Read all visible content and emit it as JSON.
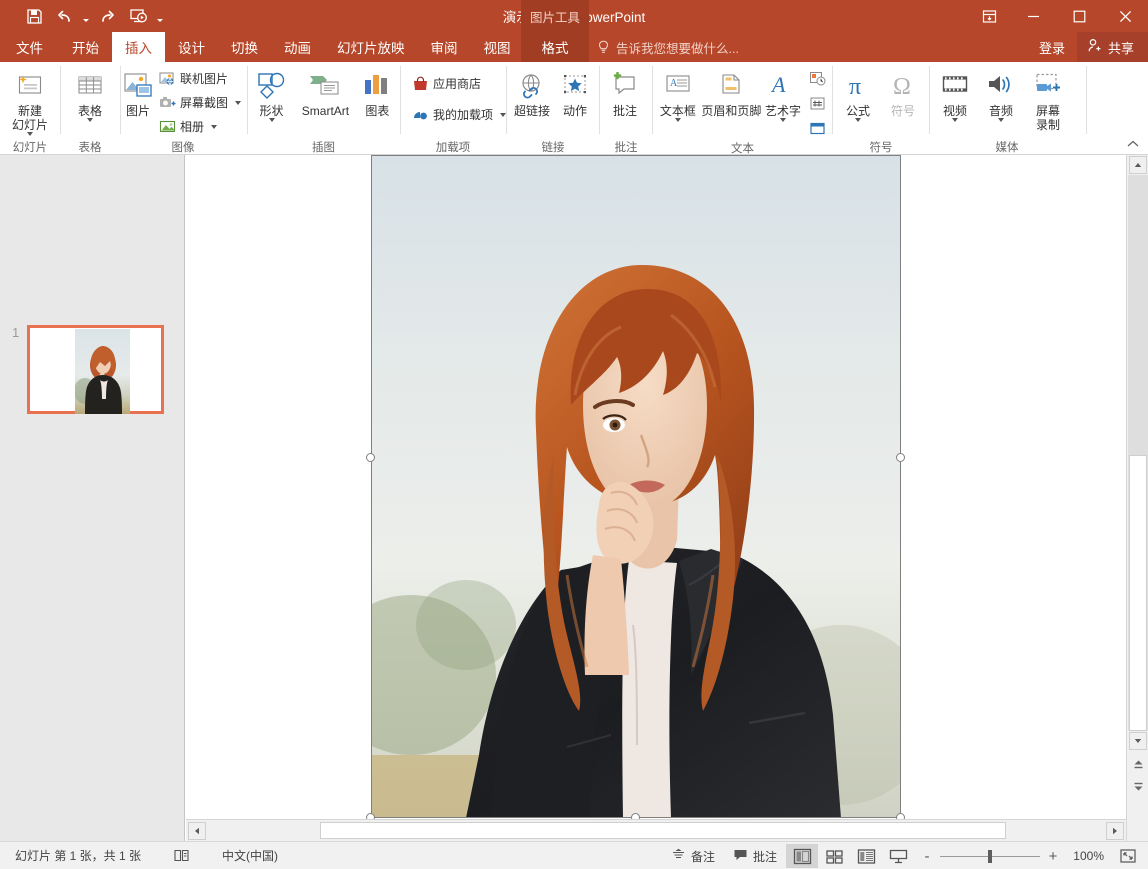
{
  "titlebar": {
    "document_title": "演示文稿1 - PowerPoint",
    "qat": [
      {
        "name": "save-icon",
        "label": "保存"
      },
      {
        "name": "undo-icon",
        "label": "撤消"
      },
      {
        "name": "redo-icon",
        "label": "恢复"
      },
      {
        "name": "start-slideshow-icon",
        "label": "从头开始"
      },
      {
        "name": "customize-qat-icon",
        "label": "自定义快速访问工具栏"
      }
    ],
    "window_controls": [
      {
        "name": "ribbon-display-options",
        "label": "功能区显示选项"
      },
      {
        "name": "minimize",
        "label": "最小化"
      },
      {
        "name": "maximize",
        "label": "最大化"
      },
      {
        "name": "close",
        "label": "关闭"
      }
    ]
  },
  "tabs": [
    {
      "label": "文件",
      "active": false
    },
    {
      "label": "开始",
      "active": false
    },
    {
      "label": "插入",
      "active": true
    },
    {
      "label": "设计",
      "active": false
    },
    {
      "label": "切换",
      "active": false
    },
    {
      "label": "动画",
      "active": false
    },
    {
      "label": "幻灯片放映",
      "active": false
    },
    {
      "label": "审阅",
      "active": false
    },
    {
      "label": "视图",
      "active": false
    }
  ],
  "contextual_tab": {
    "title": "图片工具",
    "label": "格式"
  },
  "tellme": {
    "placeholder": "告诉我您想要做什么...",
    "icon": "lightbulb-icon"
  },
  "account": {
    "signin_label": "登录",
    "share_label": "共享",
    "share_icon": "person-add-icon"
  },
  "ribbon": {
    "collapse_label": "折叠功能区",
    "groups": [
      {
        "name": "slides",
        "label": "幻灯片",
        "items": [
          {
            "type": "big",
            "name": "new-slide",
            "label": "新建\n幻灯片",
            "icon": "new-slide-icon",
            "has_caret": true
          }
        ]
      },
      {
        "name": "tables",
        "label": "表格",
        "items": [
          {
            "type": "big",
            "name": "table",
            "label": "表格",
            "icon": "table-icon",
            "has_caret": true
          }
        ]
      },
      {
        "name": "images",
        "label": "图像",
        "items": [
          {
            "type": "big",
            "name": "picture",
            "label": "图片",
            "icon": "picture-icon",
            "has_caret": false
          },
          {
            "type": "small",
            "name": "online-pictures",
            "label": "联机图片",
            "icon": "online-pictures-icon",
            "has_caret": false
          },
          {
            "type": "small",
            "name": "screenshot",
            "label": "屏幕截图",
            "icon": "screenshot-icon",
            "has_caret": true
          },
          {
            "type": "small",
            "name": "photo-album",
            "label": "相册",
            "icon": "photo-album-icon",
            "has_caret": true
          }
        ]
      },
      {
        "name": "illustrations",
        "label": "插图",
        "items": [
          {
            "type": "big",
            "name": "shapes",
            "label": "形状",
            "icon": "shapes-icon",
            "has_caret": true
          },
          {
            "type": "big",
            "name": "smartart",
            "label": "SmartArt",
            "icon": "smartart-icon",
            "has_caret": false
          },
          {
            "type": "big",
            "name": "chart",
            "label": "图表",
            "icon": "chart-icon",
            "has_caret": false
          }
        ]
      },
      {
        "name": "addins",
        "label": "加载项",
        "items": [
          {
            "type": "small",
            "name": "store",
            "label": "应用商店",
            "icon": "store-icon",
            "has_caret": false
          },
          {
            "type": "small",
            "name": "my-addins",
            "label": "我的加载项",
            "icon": "my-addins-icon",
            "has_caret": true
          }
        ]
      },
      {
        "name": "links",
        "label": "链接",
        "items": [
          {
            "type": "big",
            "name": "hyperlink",
            "label": "超链接",
            "icon": "hyperlink-icon",
            "has_caret": false
          },
          {
            "type": "big",
            "name": "action",
            "label": "动作",
            "icon": "action-icon",
            "has_caret": false
          }
        ]
      },
      {
        "name": "comments",
        "label": "批注",
        "items": [
          {
            "type": "big",
            "name": "comment",
            "label": "批注",
            "icon": "comment-icon",
            "has_caret": false
          }
        ]
      },
      {
        "name": "text",
        "label": "文本",
        "items": [
          {
            "type": "big",
            "name": "text-box",
            "label": "文本框",
            "icon": "text-box-icon",
            "has_caret": true
          },
          {
            "type": "big",
            "name": "header-footer",
            "label": "页眉和页脚",
            "icon": "header-footer-icon",
            "has_caret": false
          },
          {
            "type": "big",
            "name": "wordart",
            "label": "艺术字",
            "icon": "wordart-icon",
            "has_caret": true
          },
          {
            "type": "stack",
            "name": "date-time",
            "label": "日期和时间",
            "icon": "date-time-icon"
          },
          {
            "type": "stack",
            "name": "slide-number",
            "label": "幻灯片编号",
            "icon": "slide-number-icon"
          },
          {
            "type": "stack",
            "name": "object",
            "label": "对象",
            "icon": "object-icon"
          }
        ]
      },
      {
        "name": "symbols",
        "label": "符号",
        "items": [
          {
            "type": "big",
            "name": "equation",
            "label": "公式",
            "icon": "pi-icon",
            "has_caret": true
          },
          {
            "type": "big",
            "name": "symbol",
            "label": "符号",
            "icon": "omega-icon",
            "has_caret": false,
            "disabled": true
          }
        ]
      },
      {
        "name": "media",
        "label": "媒体",
        "items": [
          {
            "type": "big",
            "name": "video",
            "label": "视频",
            "icon": "video-icon",
            "has_caret": true
          },
          {
            "type": "big",
            "name": "audio",
            "label": "音频",
            "icon": "audio-icon",
            "has_caret": true
          },
          {
            "type": "big",
            "name": "screen-recording",
            "label": "屏幕\n录制",
            "icon": "screen-recording-icon",
            "has_caret": false
          }
        ]
      }
    ]
  },
  "thumbnails": {
    "items": [
      {
        "number": "1",
        "selected": true
      }
    ]
  },
  "slide": {
    "selected_object": "picture",
    "handles": [
      "top-left",
      "top-center",
      "top-right",
      "middle-left",
      "middle-right",
      "bottom-left",
      "bottom-center",
      "bottom-right"
    ]
  },
  "statusbar": {
    "slide_info": "幻灯片 第 1 张，共 1 张",
    "accessibility_icon": "accessibility-check-icon",
    "language": "中文(中国)",
    "notes_label": "备注",
    "comments_label": "批注",
    "views": [
      {
        "name": "normal-view",
        "label": "普通视图",
        "active": true
      },
      {
        "name": "slide-sorter-view",
        "label": "幻灯片浏览",
        "active": false
      },
      {
        "name": "reading-view",
        "label": "阅读视图",
        "active": false
      },
      {
        "name": "slideshow-view",
        "label": "幻灯片放映",
        "active": false
      }
    ],
    "zoom_out_label": "-",
    "zoom_in_label": "+",
    "zoom_percent": "100%",
    "fit_slide_label": "使幻灯片适应当前窗口"
  },
  "colors": {
    "brand": "#b7472a",
    "contextual_tab": "#a03d23",
    "selection_border": "#e8714f",
    "thumb_pane": "#e8e8e8"
  }
}
